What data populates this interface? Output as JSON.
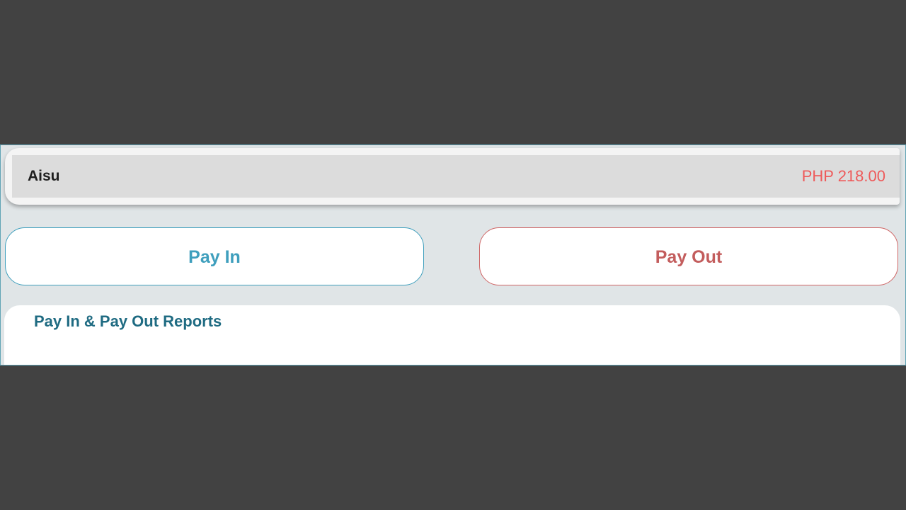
{
  "account": {
    "name": "Aisu",
    "balance": "PHP 218.00"
  },
  "actions": {
    "pay_in_label": "Pay In",
    "pay_out_label": "Pay Out"
  },
  "reports": {
    "title": "Pay In & Pay Out Reports"
  },
  "colors": {
    "pay_in_accent": "#3f9fbd",
    "pay_out_accent": "#c35d5d",
    "balance": "#ee5a5a",
    "reports_title": "#1f6b82",
    "panel_background": "#e0e5e7"
  }
}
